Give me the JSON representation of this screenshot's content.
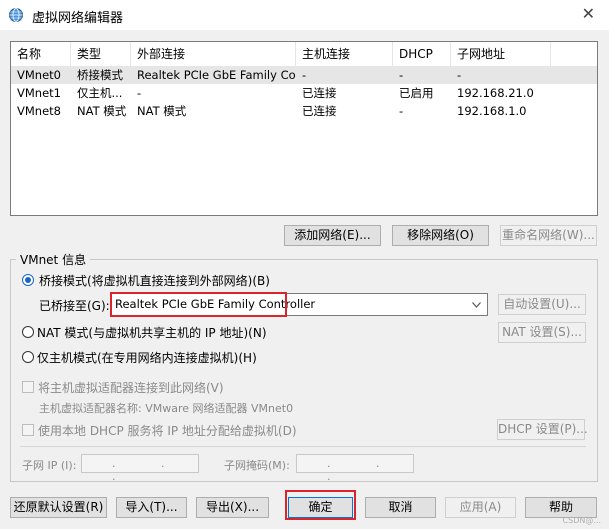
{
  "window": {
    "title": "虚拟网络编辑器",
    "close_glyph": "✕"
  },
  "table": {
    "headers": [
      "名称",
      "类型",
      "外部连接",
      "主机连接",
      "DHCP",
      "子网地址"
    ],
    "rows": [
      [
        "VMnet0",
        "桥接模式",
        "Realtek PCIe GbE Family Co...",
        "-",
        "-",
        "-"
      ],
      [
        "VMnet1",
        "仅主机...",
        "-",
        "已连接",
        "已启用",
        "192.168.21.0"
      ],
      [
        "VMnet8",
        "NAT 模式",
        "NAT 模式",
        "已连接",
        "-",
        "192.168.1.0"
      ]
    ],
    "selected_index": 0
  },
  "table_buttons": {
    "add": "添加网络(E)...",
    "remove": "移除网络(O)",
    "rename": "重命名网络(W)..."
  },
  "vmnet_info": {
    "group_title": "VMnet 信息",
    "bridged_label": "桥接模式(将虚拟机直接连接到外部网络)(B)",
    "bridged_to_label": "已桥接至(G):",
    "bridged_to_value": "Realtek PCIe GbE Family Controller",
    "auto_settings": "自动设置(U)...",
    "nat_label": "NAT 模式(与虚拟机共享主机的 IP 地址)(N)",
    "nat_settings": "NAT 设置(S)...",
    "hostonly_label": "仅主机模式(在专用网络内连接虚拟机)(H)",
    "connect_adapter_label": "将主机虚拟适配器连接到此网络(V)",
    "adapter_name_label": "主机虚拟适配器名称: VMware 网络适配器 VMnet0",
    "dhcp_label": "使用本地 DHCP 服务将 IP 地址分配给虚拟机(D)",
    "dhcp_settings": "DHCP 设置(P)...",
    "subnet_ip_label": "子网 IP (I):",
    "subnet_mask_label": "子网掩码(M):",
    "ip_dots": ". . ."
  },
  "footer": {
    "restore": "还原默认设置(R)",
    "import": "导入(T)...",
    "export": "导出(X)...",
    "ok": "确定",
    "cancel": "取消",
    "apply": "应用(A)",
    "help": "帮助"
  },
  "watermark": "CSDN@..."
}
